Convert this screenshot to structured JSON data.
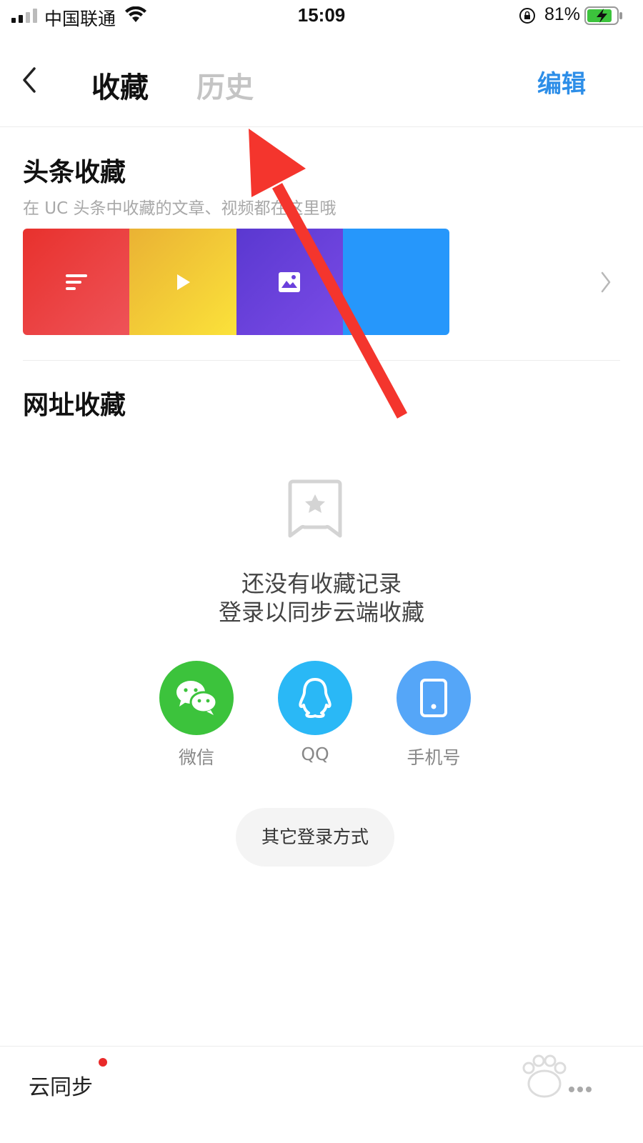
{
  "status_bar": {
    "carrier": "中国联通",
    "time": "15:09",
    "battery_percent": "81%"
  },
  "nav": {
    "tabs": [
      {
        "label": "收藏",
        "active": true
      },
      {
        "label": "历史",
        "active": false
      }
    ],
    "edit_label": "编辑"
  },
  "headline_favorites": {
    "title": "头条收藏",
    "subtitle": "在 UC 头条中收藏的文章、视频都在这里哦",
    "cards": [
      {
        "type": "article",
        "icon": "article-lines-icon"
      },
      {
        "type": "video",
        "icon": "play-icon"
      },
      {
        "type": "image",
        "icon": "image-icon"
      },
      {
        "type": "other",
        "icon": ""
      }
    ]
  },
  "url_favorites": {
    "title": "网址收藏",
    "empty_line1": "还没有收藏记录",
    "empty_line2": "登录以同步云端收藏"
  },
  "login_options": [
    {
      "label": "微信",
      "color": "#3cc33c",
      "icon": "wechat-icon"
    },
    {
      "label": "QQ",
      "color": "#2ab8f6",
      "icon": "qq-penguin-icon"
    },
    {
      "label": "手机号",
      "color": "#55a6f8",
      "icon": "phone-icon"
    }
  ],
  "other_login_label": "其它登录方式",
  "bottom": {
    "cloud_sync_label": "云同步"
  },
  "colors": {
    "accent_blue": "#2d8ee8",
    "annotation_arrow": "#f4352d"
  }
}
